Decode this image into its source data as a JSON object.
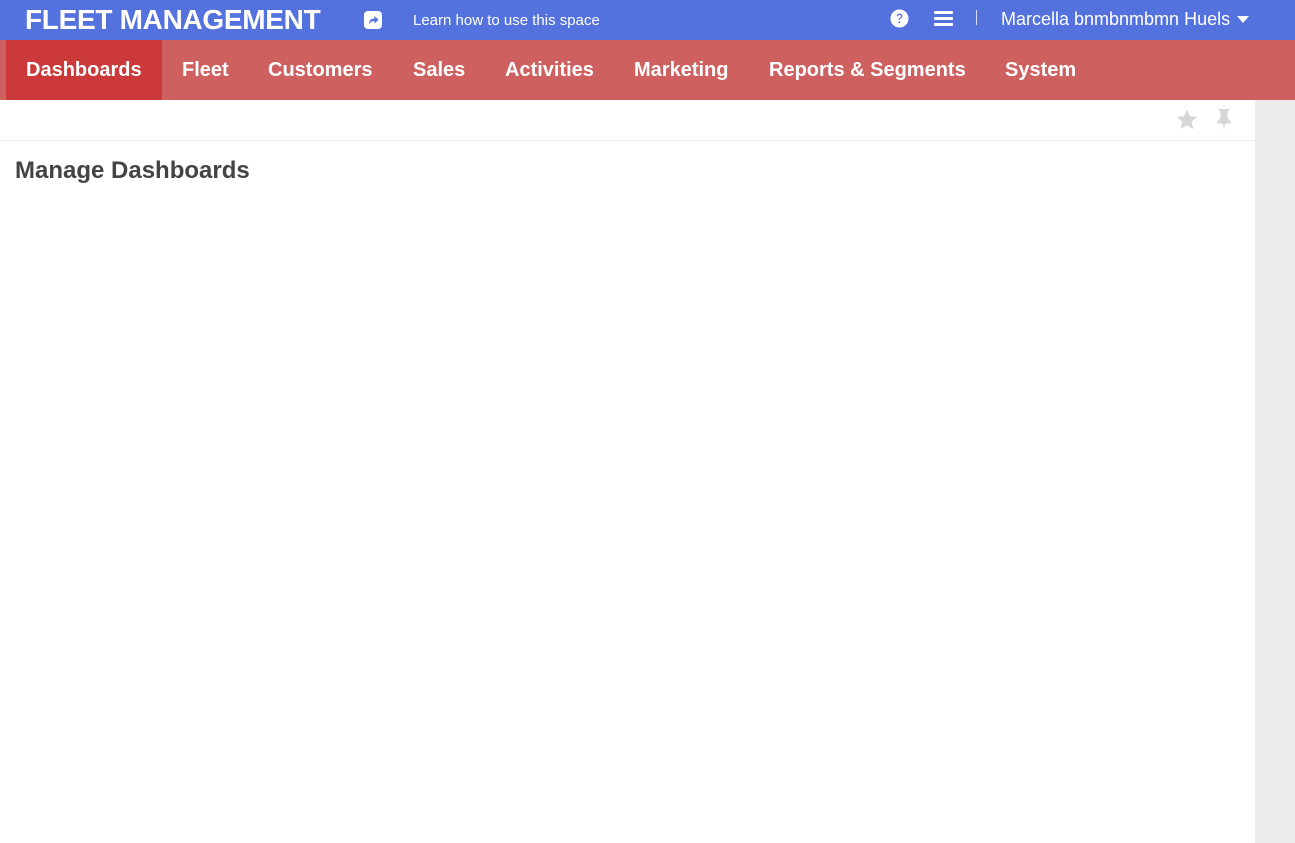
{
  "header": {
    "app_title": "FLEET MANAGEMENT",
    "learn_link": "Learn how to use this space",
    "user_name": "Marcella bnmbnmbmn Huels",
    "icons": [
      "share-icon",
      "help-icon",
      "menu-icon",
      "caret-down-icon"
    ]
  },
  "nav": {
    "items": [
      {
        "label": "Dashboards",
        "active": true
      },
      {
        "label": "Fleet",
        "active": false
      },
      {
        "label": "Customers",
        "active": false
      },
      {
        "label": "Sales",
        "active": false
      },
      {
        "label": "Activities",
        "active": false
      },
      {
        "label": "Marketing",
        "active": false
      },
      {
        "label": "Reports & Segments",
        "active": false
      },
      {
        "label": "System",
        "active": false
      }
    ]
  },
  "toolbar": {
    "icons": [
      "star-icon",
      "pin-icon"
    ]
  },
  "main": {
    "page_title": "Manage Dashboards"
  },
  "colors": {
    "topbar": "#5472DE",
    "navbar": "#CF6060",
    "nav_active": "#CB393A",
    "title_text": "#444444",
    "icon_muted": "#D6D6D6",
    "scroll_track": "#ECECEC"
  }
}
